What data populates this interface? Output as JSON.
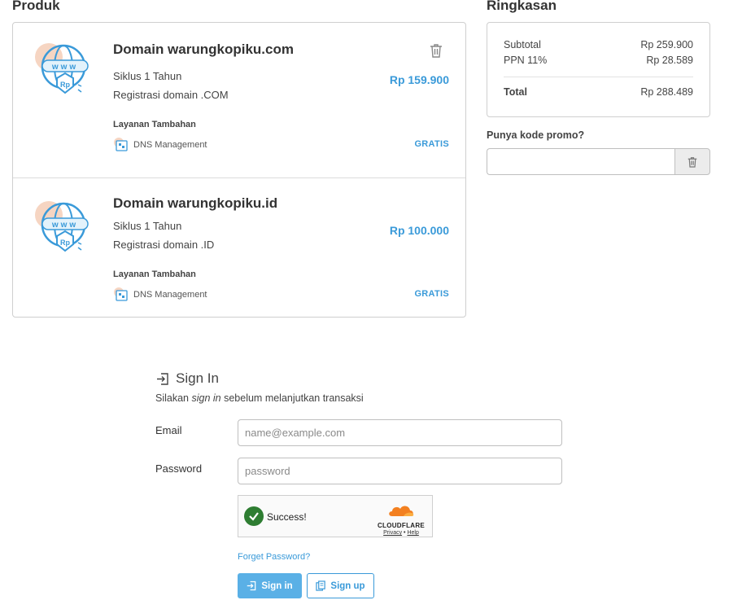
{
  "produk": {
    "title": "Produk",
    "items": [
      {
        "name": "Domain warungkopiku.com",
        "cycle": "Siklus 1 Tahun",
        "registration": "Registrasi domain .COM",
        "price": "Rp 159.900",
        "addon_title": "Layanan Tambahan",
        "addon_name": "DNS Management",
        "addon_price": "GRATIS",
        "icon_text": "www",
        "icon_badge": "Rp"
      },
      {
        "name": "Domain warungkopiku.id",
        "cycle": "Siklus 1 Tahun",
        "registration": "Registrasi domain .ID",
        "price": "Rp 100.000",
        "addon_title": "Layanan Tambahan",
        "addon_name": "DNS Management",
        "addon_price": "GRATIS",
        "icon_text": "www",
        "icon_badge": "Rp"
      }
    ]
  },
  "ringkasan": {
    "title": "Ringkasan",
    "subtotal_label": "Subtotal",
    "subtotal_value": "Rp 259.900",
    "ppn_label": "PPN 11%",
    "ppn_value": "Rp 28.589",
    "total_label": "Total",
    "total_value": "Rp 288.489",
    "promo_label": "Punya kode promo?",
    "promo_value": ""
  },
  "signin": {
    "title": "Sign In",
    "subtitle_before": "Silakan ",
    "subtitle_em": "sign in",
    "subtitle_after": " sebelum melanjutkan transaksi",
    "email_label": "Email",
    "email_placeholder": "name@example.com",
    "password_label": "Password",
    "password_placeholder": "password",
    "captcha_status": "Success!",
    "captcha_brand": "CLOUDFLARE",
    "captcha_privacy": "Privacy",
    "captcha_sep": " • ",
    "captcha_help": "Help",
    "forget_link": "Forget Password?",
    "signin_button": "Sign in",
    "signup_button": "Sign up"
  },
  "colors": {
    "accent": "#3a9ad9",
    "primary_button": "#5ab0e6",
    "success": "#2e7d32",
    "cloudflare": "#f38020"
  },
  "icons": {
    "domain": "globe-www-rp-icon",
    "delete": "trash-icon",
    "addon": "dns-icon",
    "signin": "sign-in-icon",
    "signup": "copy-icon",
    "captcha": "check-circle-icon"
  }
}
